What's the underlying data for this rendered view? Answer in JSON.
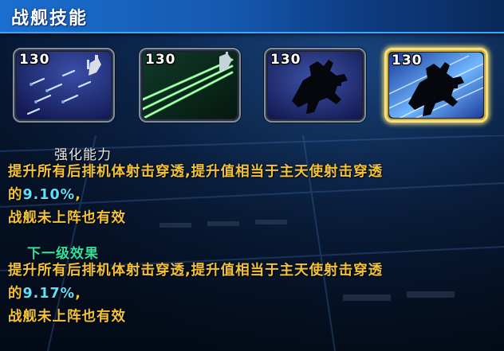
{
  "header": {
    "title": "战舰技能"
  },
  "skills": [
    {
      "level": "130",
      "icon": "missile-barrage-icon",
      "selected": false
    },
    {
      "level": "130",
      "icon": "green-laser-icon",
      "selected": false
    },
    {
      "level": "130",
      "icon": "mech-silhouette-icon",
      "selected": false
    },
    {
      "level": "130",
      "icon": "mech-silhouette-speed-icon",
      "selected": true
    }
  ],
  "current": {
    "heading": "强化能力",
    "line1": "提升所有后排机体射击穿透,提升值相当于主天使射击穿透",
    "line2_prefix": "的",
    "value": "9.10%",
    "line2_suffix": ",",
    "line3": "战舰未上阵也有效"
  },
  "next": {
    "heading": "下一级效果",
    "line1": "提升所有后排机体射击穿透,提升值相当于主天使射击穿透",
    "line2_prefix": "的",
    "value": "9.17%",
    "line2_suffix": ",",
    "line3": "战舰未上阵也有效"
  },
  "colors": {
    "header": "#1559b0",
    "description_text": "#f2c33a",
    "value_text": "#5fe0ff",
    "next_heading": "#33e0a0",
    "selected_border": "#f6e07a"
  }
}
